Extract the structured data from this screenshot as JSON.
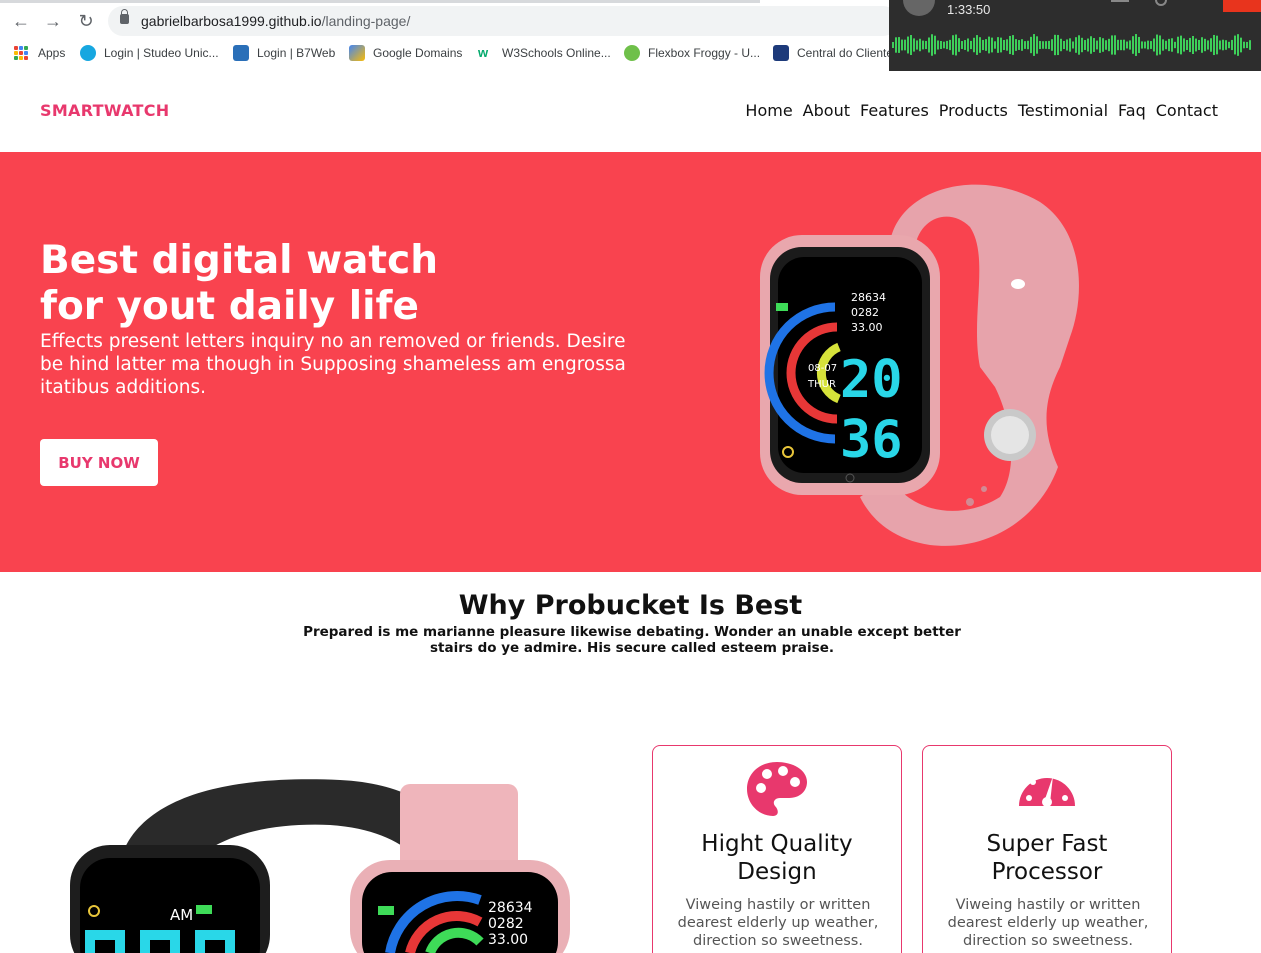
{
  "browser": {
    "url_host": "gabrielbarbosa1999.github.io",
    "url_path": "/landing-page/",
    "bookmarks": [
      {
        "label": "Apps",
        "icon": "apps-grid-icon"
      },
      {
        "label": "Login | Studeo Unic...",
        "icon": "studeo-icon"
      },
      {
        "label": "Login | B7Web",
        "icon": "b7web-icon"
      },
      {
        "label": "Google Domains",
        "icon": "google-domains-icon"
      },
      {
        "label": "W3Schools Online...",
        "icon": "w3schools-icon"
      },
      {
        "label": "Flexbox Froggy - U...",
        "icon": "frog-icon"
      },
      {
        "label": "Central do Cliente",
        "icon": "central-icon"
      }
    ]
  },
  "media_overlay": {
    "time": "1:33:50"
  },
  "header": {
    "brand": "SMARTWATCH",
    "menu": [
      "Home",
      "About",
      "Features",
      "Products",
      "Testimonial",
      "Faq",
      "Contact"
    ]
  },
  "hero": {
    "title_line1": "Best digital watch",
    "title_line2": "for yout daily life",
    "text": "Effects present letters inquiry no an removed or friends. Desire be hind latter ma though in Supposing shameless am engrossa itatibus additions.",
    "button": "BUY NOW",
    "watch": {
      "steps": "28634",
      "cal": "0282",
      "dist": "33.00",
      "date": "08-07",
      "day": "THUR",
      "hour": "20",
      "minute": "36"
    }
  },
  "why": {
    "title": "Why Probucket Is Best",
    "text": "Prepared is me marianne pleasure likewise debating. Wonder an unable except better stairs do ye admire. His secure called esteem praise."
  },
  "pair_watch": {
    "am": "AM",
    "steps": "28634",
    "cal": "0282",
    "dist": "33.00"
  },
  "features": [
    {
      "icon": "palette-icon",
      "title_line1": "Hight Quality",
      "title_line2": "Design",
      "text": "Viweing hastily or written dearest elderly up weather, direction so sweetness."
    },
    {
      "icon": "speedometer-icon",
      "title_line1": "Super Fast",
      "title_line2": "Processor",
      "text": "Viweing hastily or written dearest elderly up weather, direction so sweetness."
    }
  ],
  "colors": {
    "accent": "#e8386d",
    "hero_bg": "#f9434f"
  }
}
